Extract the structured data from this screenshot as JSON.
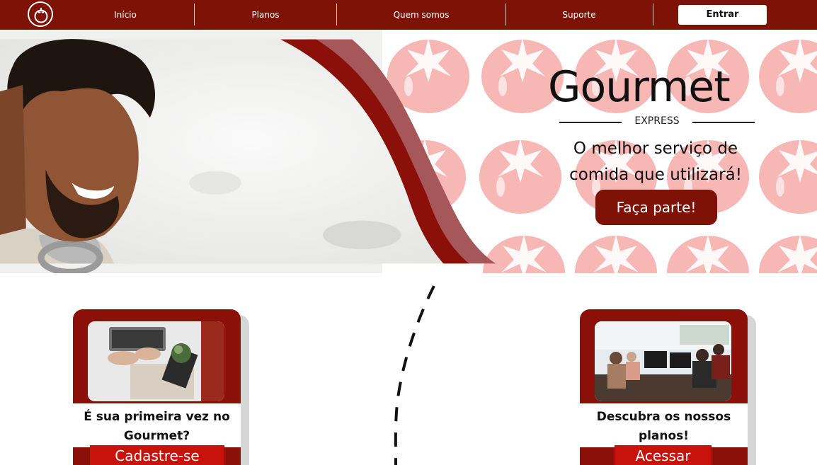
{
  "nav": {
    "items": [
      {
        "label": "Início"
      },
      {
        "label": "Planos"
      },
      {
        "label": "Quem somos"
      },
      {
        "label": "Suporte"
      }
    ],
    "login_label": "Entrar"
  },
  "hero": {
    "brand_main": "Gourmet",
    "brand_sub": "EXPRESS",
    "tagline": "O melhor serviço de comida que utilizará!",
    "cta_label": "Faça parte!"
  },
  "cards": [
    {
      "title": "É sua primeira vez no Gourmet?",
      "button_label": "Cadastre-se"
    },
    {
      "title": "Descubra os nossos planos!",
      "button_label": "Acessar"
    }
  ],
  "colors": {
    "brand": "#7f1206",
    "button_red": "#c8130d",
    "tomato_pattern": "#f7b7b5"
  }
}
